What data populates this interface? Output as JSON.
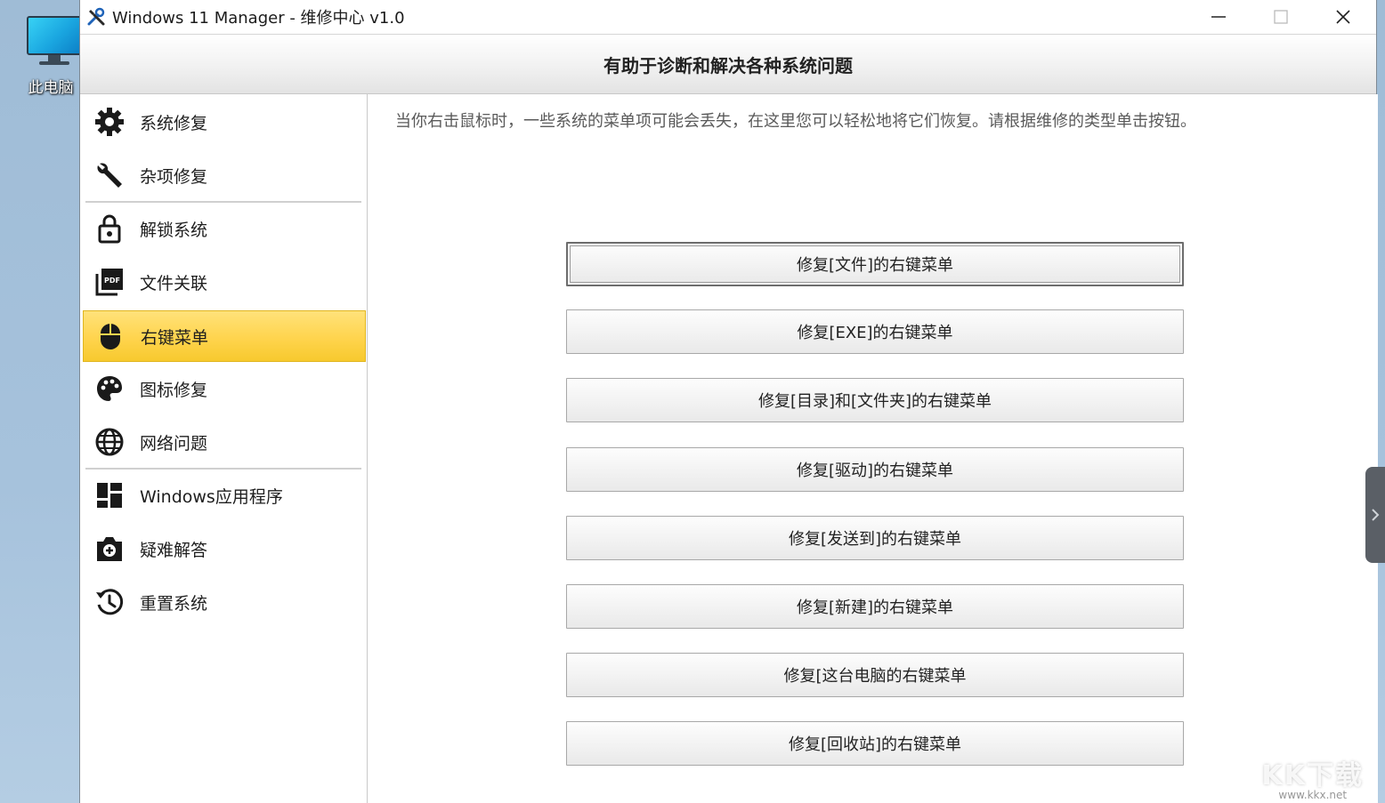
{
  "desktop": {
    "icon_label": "此电脑"
  },
  "window": {
    "title": "Windows 11 Manager - 维修中心 v1.0",
    "header_title": "有助于诊断和解决各种系统问题"
  },
  "sidebar": {
    "items": [
      {
        "label": "系统修复",
        "icon": "gear-icon"
      },
      {
        "label": "杂项修复",
        "icon": "wrench-icon"
      },
      {
        "label": "解锁系统",
        "icon": "unlock-icon"
      },
      {
        "label": "文件关联",
        "icon": "pdf-file-icon"
      },
      {
        "label": "右键菜单",
        "icon": "mouse-icon",
        "active": true
      },
      {
        "label": "图标修复",
        "icon": "palette-icon"
      },
      {
        "label": "网络问题",
        "icon": "globe-icon"
      },
      {
        "label": "Windows应用程序",
        "icon": "windows-apps-icon"
      },
      {
        "label": "疑难解答",
        "icon": "camera-help-icon"
      },
      {
        "label": "重置系统",
        "icon": "history-icon"
      }
    ]
  },
  "content": {
    "intro": "当你右击鼠标时，一些系统的菜单项可能会丢失，在这里您可以轻松地将它们恢复。请根据维修的类型单击按钮。",
    "buttons": [
      "修复[文件]的右键菜单",
      "修复[EXE]的右键菜单",
      "修复[目录]和[文件夹]的右键菜单",
      "修复[驱动]的右键菜单",
      "修复[发送到]的右键菜单",
      "修复[新建]的右键菜单",
      "修复[这台电脑的右键菜单",
      "修复[回收站]的右键菜单"
    ]
  },
  "watermark": {
    "main": "KK下载",
    "url": "www.kkx.net"
  },
  "colors": {
    "active_item": "#ffd44d",
    "accent_dark": "#222222"
  }
}
